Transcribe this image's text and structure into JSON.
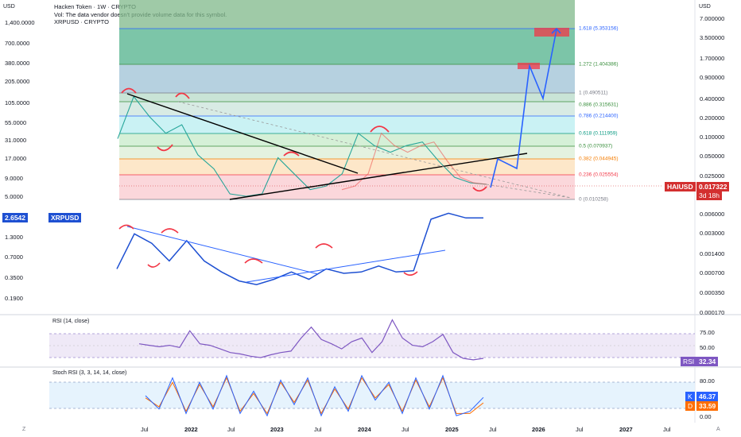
{
  "header": {
    "title": "Hacken Token · 1W · CRYPTO",
    "volume_note": "Vol: The data vendor doesn't provide volume data for this symbol.",
    "overlay_symbol": "XRPUSD · CRYPTO"
  },
  "currency_left": "USD",
  "currency_right": "USD",
  "left_axis_ticks": [
    "1,400.0000",
    "700.0000",
    "380.0000",
    "205.0000",
    "105.0000",
    "55.0000",
    "31.0000",
    "17.0000",
    "9.0000",
    "5.0000"
  ],
  "right_axis_ticks": [
    "7.000000",
    "3.500000",
    "1.700000",
    "0.900000",
    "0.400000",
    "0.200000",
    "0.100000",
    "0.050000",
    "0.025000"
  ],
  "xrp_left_ticks": [
    "1.3000",
    "0.7000",
    "0.3500",
    "0.1900"
  ],
  "xrp_right_ticks": [
    "0.006000",
    "0.003000",
    "0.001400",
    "0.000700",
    "0.000350",
    "0.000170"
  ],
  "x_axis_ticks": [
    "Jul",
    "2022",
    "Jul",
    "2023",
    "Jul",
    "2024",
    "Jul",
    "2025",
    "Jul",
    "2026",
    "Jul",
    "2027",
    "Jul"
  ],
  "fib_levels": [
    {
      "label": "1.618 (5.353156)",
      "color": "#2962ff"
    },
    {
      "label": "1.272 (1.404386)",
      "color": "#388e3c"
    },
    {
      "label": "1 (0.490511)",
      "color": "#787b86"
    },
    {
      "label": "0.886 (0.315631)",
      "color": "#388e3c"
    },
    {
      "label": "0.786 (0.214400)",
      "color": "#2962ff"
    },
    {
      "label": "0.618 (0.111959)",
      "color": "#089981"
    },
    {
      "label": "0.5 (0.070937)",
      "color": "#388e3c"
    },
    {
      "label": "0.382 (0.044945)",
      "color": "#f57c00"
    },
    {
      "label": "0.236 (0.025554)",
      "color": "#f23645"
    },
    {
      "label": "0 (0.010258)",
      "color": "#787b86"
    }
  ],
  "price_tag": {
    "symbol": "HAIUSD",
    "price": "0.017322",
    "countdown": "3d 18h",
    "color": "#d32f2f"
  },
  "xrp_tag": {
    "value": "2.6542",
    "symbol": "XRPUSD",
    "color": "#1e50d2"
  },
  "rsi": {
    "title": "RSI (14, close)",
    "ticks": [
      "75.00",
      "50.00",
      "25.00"
    ],
    "tag_label": "RSI",
    "tag_value": "32.34",
    "color": "#7e57c2"
  },
  "stoch": {
    "title": "Stoch RSI (3, 3, 14, 14, close)",
    "ticks": [
      "80.00",
      "20.00",
      "0.00"
    ],
    "k_label": "K",
    "k_value": "46.37",
    "d_label": "D",
    "d_value": "33.59",
    "k_color": "#2962ff",
    "d_color": "#ff6d00"
  },
  "chart_data": [
    {
      "type": "line",
      "series": [
        {
          "name": "HAIUSD",
          "values": [
            0.09,
            0.42,
            0.2,
            0.11,
            0.15,
            0.05,
            0.03,
            0.012,
            0.011,
            0.012,
            0.045,
            0.025,
            0.014,
            0.016,
            0.025,
            0.11,
            0.07,
            0.055,
            0.07,
            0.08,
            0.04,
            0.022,
            0.018,
            0.017
          ]
        }
      ],
      "projection": [
        0.017,
        0.045,
        0.03,
        1.4,
        0.4,
        5.35
      ],
      "ylim": [
        0.008,
        8.0
      ]
    },
    {
      "type": "line",
      "series": [
        {
          "name": "XRPUSD",
          "values": [
            0.55,
            1.6,
            1.2,
            0.7,
            1.3,
            0.7,
            0.5,
            0.38,
            0.34,
            0.4,
            0.5,
            0.4,
            0.55,
            0.48,
            0.5,
            0.6,
            0.5,
            0.52,
            2.5,
            3.0,
            2.6,
            2.6
          ]
        }
      ],
      "ylim": [
        0.15,
        3.5
      ]
    },
    {
      "type": "line",
      "series": [
        {
          "name": "RSI",
          "values": [
            52,
            50,
            48,
            50,
            47,
            70,
            52,
            50,
            45,
            40,
            38,
            35,
            33,
            37,
            40,
            42,
            60,
            75,
            58,
            52,
            45,
            55,
            60,
            40,
            55,
            85,
            60,
            50,
            48,
            55,
            65,
            40,
            32,
            30,
            32
          ]
        }
      ],
      "ylim": [
        20,
        90
      ]
    },
    {
      "type": "line",
      "series": [
        {
          "name": "K",
          "values": [
            50,
            20,
            90,
            10,
            80,
            20,
            95,
            10,
            60,
            5,
            85,
            30,
            90,
            5,
            70,
            15,
            95,
            40,
            80,
            10,
            90,
            20,
            95,
            5,
            15,
            46
          ]
        },
        {
          "name": "D",
          "values": [
            45,
            25,
            80,
            15,
            75,
            25,
            90,
            15,
            55,
            10,
            80,
            35,
            85,
            10,
            65,
            20,
            90,
            45,
            75,
            15,
            85,
            25,
            90,
            10,
            10,
            34
          ]
        }
      ],
      "ylim": [
        0,
        100
      ]
    }
  ]
}
